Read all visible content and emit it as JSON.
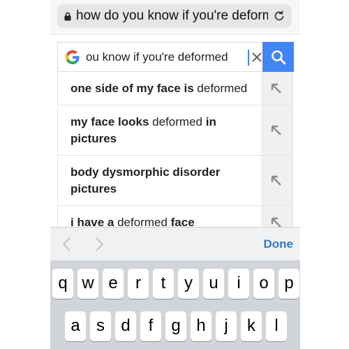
{
  "browser": {
    "url_text": "how do you know if you're deform"
  },
  "search": {
    "query": "ou know if you're deformed",
    "logo": "G"
  },
  "suggestions": [
    {
      "parts": [
        {
          "t": "one side of my face is",
          "b": true
        },
        {
          "t": " deformed",
          "b": false
        }
      ]
    },
    {
      "parts": [
        {
          "t": "my face looks",
          "b": true
        },
        {
          "t": " deformed ",
          "b": false
        },
        {
          "t": "in pictures",
          "b": true
        }
      ]
    },
    {
      "parts": [
        {
          "t": "body dysmorphic disorder pictures",
          "b": true
        }
      ]
    },
    {
      "parts": [
        {
          "t": "i have a",
          "b": true
        },
        {
          "t": " deformed ",
          "b": false
        },
        {
          "t": "face",
          "b": true
        }
      ]
    }
  ],
  "accessory": {
    "done_label": "Done"
  },
  "keyboard": {
    "row1": [
      "q",
      "w",
      "e",
      "r",
      "t",
      "y",
      "u",
      "i",
      "o",
      "p"
    ],
    "row2": [
      "a",
      "s",
      "d",
      "f",
      "g",
      "h",
      "j",
      "k",
      "l"
    ]
  },
  "colors": {
    "google_blue": "#4285f4",
    "done_blue": "#3478d1"
  }
}
